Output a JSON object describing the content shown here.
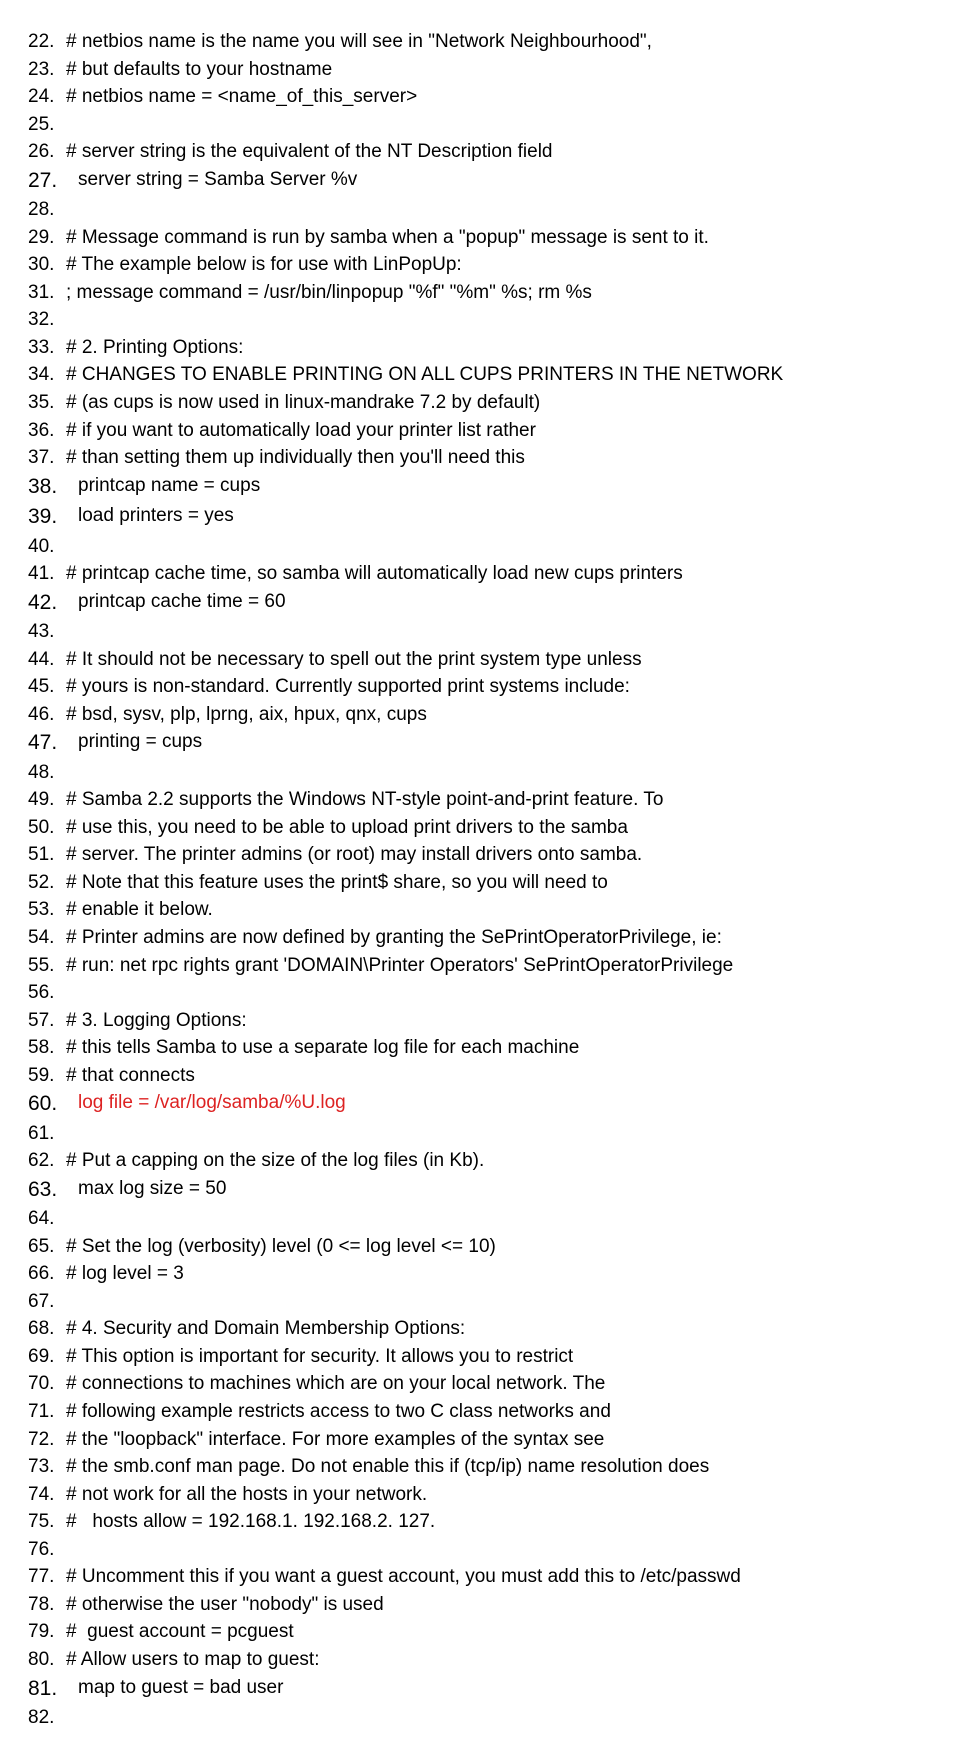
{
  "lines": [
    {
      "n": "22.",
      "big": false,
      "text": "# netbios name is the name you will see in \"Network Neighbourhood\",",
      "indent": false,
      "red": false
    },
    {
      "n": "23.",
      "big": false,
      "text": "# but defaults to your hostname",
      "indent": false,
      "red": false
    },
    {
      "n": "24.",
      "big": false,
      "text": "# netbios name = <name_of_this_server>",
      "indent": false,
      "red": false
    },
    {
      "n": "25.",
      "big": false,
      "text": "",
      "indent": false,
      "red": false
    },
    {
      "n": "26.",
      "big": false,
      "text": "# server string is the equivalent of the NT Description field",
      "indent": false,
      "red": false
    },
    {
      "n": "27.",
      "big": true,
      "text": "server string = Samba Server %v",
      "indent": true,
      "red": false
    },
    {
      "n": "28.",
      "big": false,
      "text": "",
      "indent": false,
      "red": false
    },
    {
      "n": "29.",
      "big": false,
      "text": "# Message command is run by samba when a \"popup\" message is sent to it.",
      "indent": false,
      "red": false
    },
    {
      "n": "30.",
      "big": false,
      "text": "# The example below is for use with LinPopUp:",
      "indent": false,
      "red": false
    },
    {
      "n": "31.",
      "big": false,
      "text": "; message command = /usr/bin/linpopup \"%f\" \"%m\" %s; rm %s",
      "indent": false,
      "red": false
    },
    {
      "n": "32.",
      "big": false,
      "text": "",
      "indent": false,
      "red": false
    },
    {
      "n": "33.",
      "big": false,
      "text": "# 2. Printing Options:",
      "indent": false,
      "red": false
    },
    {
      "n": "34.",
      "big": false,
      "text": "# CHANGES TO ENABLE PRINTING ON ALL CUPS PRINTERS IN THE NETWORK",
      "indent": false,
      "red": false
    },
    {
      "n": "35.",
      "big": false,
      "text": "# (as cups is now used in linux-mandrake 7.2 by default)",
      "indent": false,
      "red": false
    },
    {
      "n": "36.",
      "big": false,
      "text": "# if you want to automatically load your printer list rather",
      "indent": false,
      "red": false
    },
    {
      "n": "37.",
      "big": false,
      "text": "# than setting them up individually then you'll need this",
      "indent": false,
      "red": false
    },
    {
      "n": "38.",
      "big": true,
      "text": "printcap name = cups",
      "indent": true,
      "red": false
    },
    {
      "n": "39.",
      "big": true,
      "text": "load printers = yes",
      "indent": true,
      "red": false
    },
    {
      "n": "40.",
      "big": false,
      "text": "",
      "indent": false,
      "red": false
    },
    {
      "n": "41.",
      "big": false,
      "text": "# printcap cache time, so samba will automatically load new cups printers",
      "indent": false,
      "red": false
    },
    {
      "n": "42.",
      "big": true,
      "text": "printcap cache time = 60",
      "indent": true,
      "red": false
    },
    {
      "n": "43.",
      "big": false,
      "text": "",
      "indent": false,
      "red": false
    },
    {
      "n": "44.",
      "big": false,
      "text": "# It should not be necessary to spell out the print system type unless",
      "indent": false,
      "red": false
    },
    {
      "n": "45.",
      "big": false,
      "text": "# yours is non-standard. Currently supported print systems include:",
      "indent": false,
      "red": false
    },
    {
      "n": "46.",
      "big": false,
      "text": "# bsd, sysv, plp, lprng, aix, hpux, qnx, cups",
      "indent": false,
      "red": false
    },
    {
      "n": "47.",
      "big": true,
      "text": "printing = cups",
      "indent": true,
      "red": false
    },
    {
      "n": "48.",
      "big": false,
      "text": "",
      "indent": false,
      "red": false
    },
    {
      "n": "49.",
      "big": false,
      "text": "# Samba 2.2 supports the Windows NT-style point-and-print feature. To",
      "indent": false,
      "red": false
    },
    {
      "n": "50.",
      "big": false,
      "text": "# use this, you need to be able to upload print drivers to the samba",
      "indent": false,
      "red": false
    },
    {
      "n": "51.",
      "big": false,
      "text": "# server. The printer admins (or root) may install drivers onto samba.",
      "indent": false,
      "red": false
    },
    {
      "n": "52.",
      "big": false,
      "text": "# Note that this feature uses the print$ share, so you will need to",
      "indent": false,
      "red": false
    },
    {
      "n": "53.",
      "big": false,
      "text": "# enable it below.",
      "indent": false,
      "red": false
    },
    {
      "n": "54.",
      "big": false,
      "text": "# Printer admins are now defined by granting the SePrintOperatorPrivilege, ie:",
      "indent": false,
      "red": false
    },
    {
      "n": "55.",
      "big": false,
      "text": "# run: net rpc rights grant 'DOMAIN\\Printer Operators' SePrintOperatorPrivilege",
      "indent": false,
      "red": false
    },
    {
      "n": "56.",
      "big": false,
      "text": "",
      "indent": false,
      "red": false
    },
    {
      "n": "57.",
      "big": false,
      "text": "# 3. Logging Options:",
      "indent": false,
      "red": false
    },
    {
      "n": "58.",
      "big": false,
      "text": "# this tells Samba to use a separate log file for each machine",
      "indent": false,
      "red": false
    },
    {
      "n": "59.",
      "big": false,
      "text": "# that connects",
      "indent": false,
      "red": false
    },
    {
      "n": "60.",
      "big": true,
      "text": "log file = /var/log/samba/%U.log",
      "indent": true,
      "red": true
    },
    {
      "n": "61.",
      "big": false,
      "text": "",
      "indent": false,
      "red": false
    },
    {
      "n": "62.",
      "big": false,
      "text": "# Put a capping on the size of the log files (in Kb).",
      "indent": false,
      "red": false
    },
    {
      "n": "63.",
      "big": true,
      "text": "max log size = 50",
      "indent": true,
      "red": false
    },
    {
      "n": "64.",
      "big": false,
      "text": "",
      "indent": false,
      "red": false
    },
    {
      "n": "65.",
      "big": false,
      "text": "# Set the log (verbosity) level (0 <= log level <= 10)",
      "indent": false,
      "red": false
    },
    {
      "n": "66.",
      "big": false,
      "text": "# log level = 3",
      "indent": false,
      "red": false
    },
    {
      "n": "67.",
      "big": false,
      "text": "",
      "indent": false,
      "red": false
    },
    {
      "n": "68.",
      "big": false,
      "text": "# 4. Security and Domain Membership Options:",
      "indent": false,
      "red": false
    },
    {
      "n": "69.",
      "big": false,
      "text": "# This option is important for security. It allows you to restrict",
      "indent": false,
      "red": false
    },
    {
      "n": "70.",
      "big": false,
      "text": "# connections to machines which are on your local network. The",
      "indent": false,
      "red": false
    },
    {
      "n": "71.",
      "big": false,
      "text": "# following example restricts access to two C class networks and",
      "indent": false,
      "red": false
    },
    {
      "n": "72.",
      "big": false,
      "text": "# the \"loopback\" interface. For more examples of the syntax see",
      "indent": false,
      "red": false
    },
    {
      "n": "73.",
      "big": false,
      "text": "# the smb.conf man page. Do not enable this if (tcp/ip) name resolution does",
      "indent": false,
      "red": false
    },
    {
      "n": "74.",
      "big": false,
      "text": "# not work for all the hosts in your network.",
      "indent": false,
      "red": false
    },
    {
      "n": "75.",
      "big": false,
      "text": "#   hosts allow = 192.168.1. 192.168.2. 127.",
      "indent": false,
      "red": false
    },
    {
      "n": "76.",
      "big": false,
      "text": "",
      "indent": false,
      "red": false
    },
    {
      "n": "77.",
      "big": false,
      "text": "# Uncomment this if you want a guest account, you must add this to /etc/passwd",
      "indent": false,
      "red": false
    },
    {
      "n": "78.",
      "big": false,
      "text": "# otherwise the user \"nobody\" is used",
      "indent": false,
      "red": false
    },
    {
      "n": "79.",
      "big": false,
      "text": "#  guest account = pcguest",
      "indent": false,
      "red": false
    },
    {
      "n": "80.",
      "big": false,
      "text": "# Allow users to map to guest:",
      "indent": false,
      "red": false
    },
    {
      "n": "81.",
      "big": true,
      "text": "map to guest = bad user",
      "indent": true,
      "red": false
    },
    {
      "n": "82.",
      "big": false,
      "text": "",
      "indent": false,
      "red": false
    }
  ]
}
